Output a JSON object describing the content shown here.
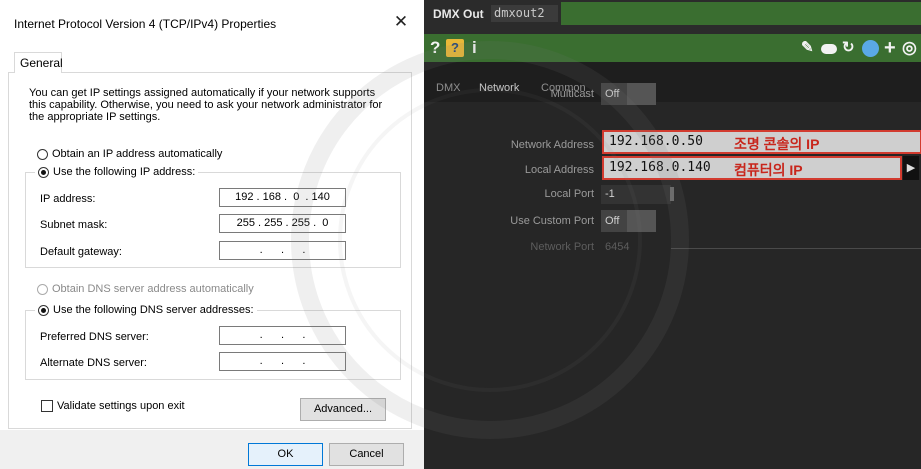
{
  "dialog": {
    "title": "Internet Protocol Version 4 (TCP/IPv4) Properties",
    "close_glyph": "✕",
    "tab_label": "General",
    "description": "You can get IP settings assigned automatically if your network supports this capability. Otherwise, you need to ask your network administrator for the appropriate IP settings.",
    "obtain_ip_auto": "Obtain an IP address automatically",
    "use_following_ip": "Use the following IP address:",
    "ip_label": "IP address:",
    "ip_value": "192 . 168 .  0  . 140",
    "subnet_label": "Subnet mask:",
    "subnet_value": "255 . 255 . 255 .  0",
    "gateway_label": "Default gateway:",
    "gateway_value": " .      .      . ",
    "obtain_dns_auto": "Obtain DNS server address automatically",
    "use_following_dns": "Use the following DNS server addresses:",
    "preferred_dns_label": "Preferred DNS server:",
    "preferred_dns_value": " .      .      . ",
    "alternate_dns_label": "Alternate DNS server:",
    "alternate_dns_value": " .      .      . ",
    "validate_label": "Validate settings upon exit",
    "advanced_button": "Advanced...",
    "ok_button": "OK",
    "cancel_button": "Cancel"
  },
  "td": {
    "op_type": "DMX Out",
    "op_name": "dmxout2",
    "tabs": [
      "DMX",
      "Network",
      "Common"
    ],
    "active_tab": "Network",
    "params": {
      "multicast_label": "Multicast",
      "multicast_value": "Off",
      "network_address_label": "Network Address",
      "network_address_value": "192.168.0.50",
      "network_address_note": "조명 콘솔의 IP",
      "local_address_label": "Local Address",
      "local_address_value": "192.168.0.140",
      "local_address_note": "컴퓨터의 IP",
      "local_port_label": "Local Port",
      "local_port_value": "-1",
      "use_custom_port_label": "Use Custom Port",
      "use_custom_port_value": "Off",
      "network_port_label": "Network Port",
      "network_port_value": "6454"
    },
    "arrow_glyph": "▶",
    "icons": [
      "help-icon",
      "python-help-icon",
      "info-icon",
      "edit-icon",
      "comment-icon",
      "cook-icon",
      "python-icon",
      "add-icon",
      "viewer-icon"
    ],
    "colors": {
      "toolbar_green": "#3a6e30",
      "highlight_red": "#d23b2f",
      "note_red": "#c8261c"
    }
  }
}
